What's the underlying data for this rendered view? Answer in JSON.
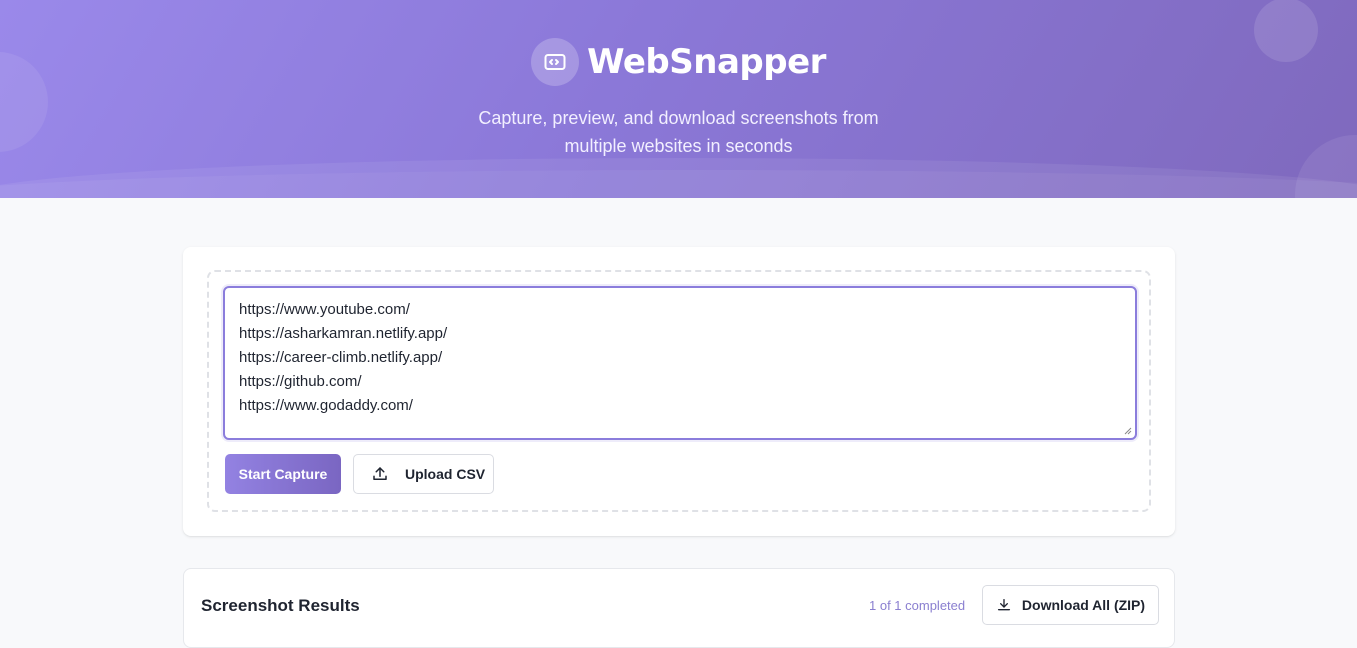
{
  "header": {
    "app_title": "WebSnapper",
    "logo_icon": "screenshot-code-icon",
    "tagline_line1": "Capture, preview, and download screenshots from",
    "tagline_line2": "multiple websites in seconds"
  },
  "input_card": {
    "urls": [
      "https://www.youtube.com/",
      "https://asharkamran.netlify.app/",
      "https://career-climb.netlify.app/",
      "https://github.com/",
      "https://www.godaddy.com/"
    ],
    "start_button_label": "Start Capture",
    "upload_button_label": "Upload CSV",
    "upload_icon": "upload-icon"
  },
  "results": {
    "title": "Screenshot Results",
    "progress_text": "1 of 1 completed",
    "download_all_label": "Download All (ZIP)",
    "download_icon": "download-icon"
  },
  "colors": {
    "accent": "#8b7ddc",
    "header_gradient_start": "#9a89ea",
    "header_gradient_end": "#7f69bd",
    "page_background": "#f8f9fb"
  }
}
